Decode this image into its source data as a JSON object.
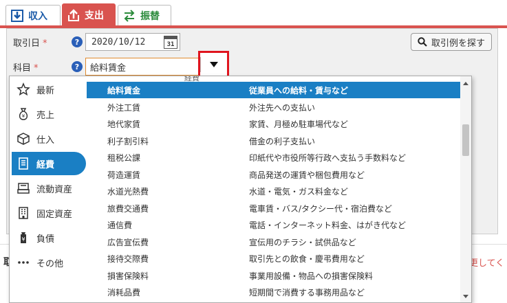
{
  "tabs": [
    {
      "label": "収入",
      "icon": "download-icon",
      "color": "#1a5aa8"
    },
    {
      "label": "支出",
      "icon": "upload-icon",
      "color": "#ffffff"
    },
    {
      "label": "振替",
      "icon": "transfer-arrows-icon",
      "color": "#2a8a3a"
    }
  ],
  "form": {
    "date_label": "取引日",
    "date_value": "2020/10/12",
    "calendar_day": "31",
    "account_label": "科目",
    "account_value": "給料賃金",
    "required_mark": "*",
    "help_mark": "?",
    "search_examples_label": "取引例を探す"
  },
  "background": {
    "left_fragment": "取",
    "right_fragment": "更してく"
  },
  "categories": [
    {
      "label": "最新",
      "icon": "star-icon",
      "active": false
    },
    {
      "label": "売上",
      "icon": "money-bag-icon",
      "active": false
    },
    {
      "label": "仕入",
      "icon": "box-icon",
      "active": false
    },
    {
      "label": "経費",
      "icon": "receipt-icon",
      "active": true
    },
    {
      "label": "流動資産",
      "icon": "cash-register-icon",
      "active": false
    },
    {
      "label": "固定資産",
      "icon": "building-icon",
      "active": false
    },
    {
      "label": "負債",
      "icon": "money-bag-yen-icon",
      "active": false
    },
    {
      "label": "その他",
      "icon": "ellipsis-icon",
      "active": false
    }
  ],
  "partial_row": "経費",
  "accounts": [
    {
      "name": "給料賃金",
      "desc": "従業員への給料・賃与など",
      "selected": true
    },
    {
      "name": "外注工賃",
      "desc": "外注先への支払い",
      "selected": false
    },
    {
      "name": "地代家賃",
      "desc": "家賃、月極め駐車場代など",
      "selected": false
    },
    {
      "name": "利子割引料",
      "desc": "借金の利子支払い",
      "selected": false
    },
    {
      "name": "租税公課",
      "desc": "印紙代や市役所等行政へ支払う手数料など",
      "selected": false
    },
    {
      "name": "荷造運賃",
      "desc": "商品発送の運賃や梱包費用など",
      "selected": false
    },
    {
      "name": "水道光熱費",
      "desc": "水道・電気・ガス料金など",
      "selected": false
    },
    {
      "name": "旅費交通費",
      "desc": "電車賃・バス/タクシー代・宿泊費など",
      "selected": false
    },
    {
      "name": "通信費",
      "desc": "電話・インターネット料金、はがき代など",
      "selected": false
    },
    {
      "name": "広告宣伝費",
      "desc": "宣伝用のチラシ・試供品など",
      "selected": false
    },
    {
      "name": "接待交際費",
      "desc": "取引先との飲食・慶弔費用など",
      "selected": false
    },
    {
      "name": "損害保険料",
      "desc": "事業用設備・物品への損害保険料",
      "selected": false
    },
    {
      "name": "消耗品費",
      "desc": "短期間で消費する事務用品など",
      "selected": false
    }
  ],
  "colors": {
    "expense_red": "#d9534f",
    "selection_blue": "#1a7fc4",
    "highlight_red": "#e0141e"
  }
}
